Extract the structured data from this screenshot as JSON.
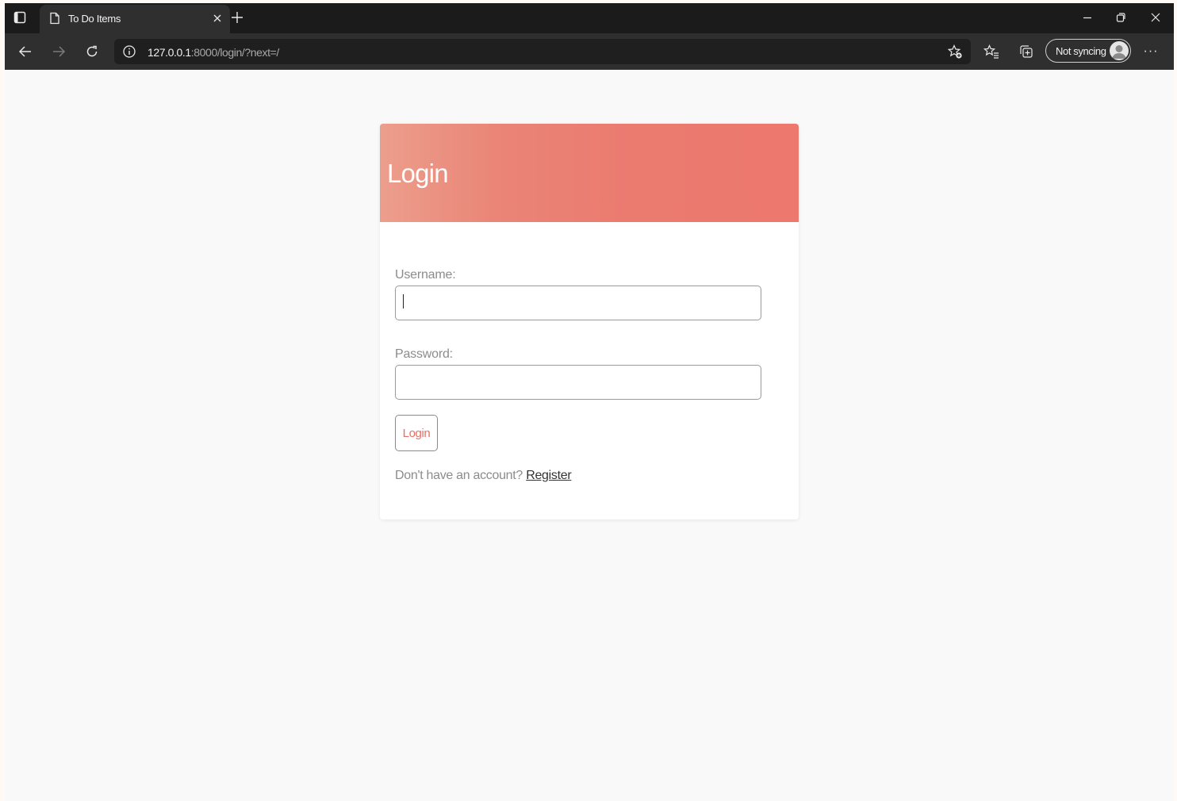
{
  "browser": {
    "tab": {
      "title": "To Do Items"
    },
    "address": {
      "host": "127.0.0.1",
      "path": ":8000/login/?next=/"
    },
    "sync": {
      "label": "Not syncing"
    },
    "more": "···"
  },
  "login_card": {
    "title": "Login",
    "username_label": "Username:",
    "username_value": "",
    "password_label": "Password:",
    "password_value": "",
    "submit_label": "Login",
    "register_prompt": "Don't have an account?",
    "register_link": "Register"
  },
  "colors": {
    "header_gradient_start": "#ec9e8c",
    "header_gradient_end": "#ec786e",
    "button_text": "#e86d65",
    "browser_dark": "#1b1b1b",
    "toolbar_dark": "#2f2f2f"
  },
  "icons": {
    "tab_actions": "tab-actions-icon",
    "page": "page-icon",
    "close": "close-icon",
    "new_tab": "plus-icon",
    "back": "back-arrow-icon",
    "forward": "forward-arrow-icon",
    "refresh": "refresh-icon",
    "site_info": "info-icon",
    "add_favorite": "star-plus-icon",
    "favorites": "favorites-icon",
    "collections": "collections-icon",
    "profile": "avatar-icon"
  }
}
